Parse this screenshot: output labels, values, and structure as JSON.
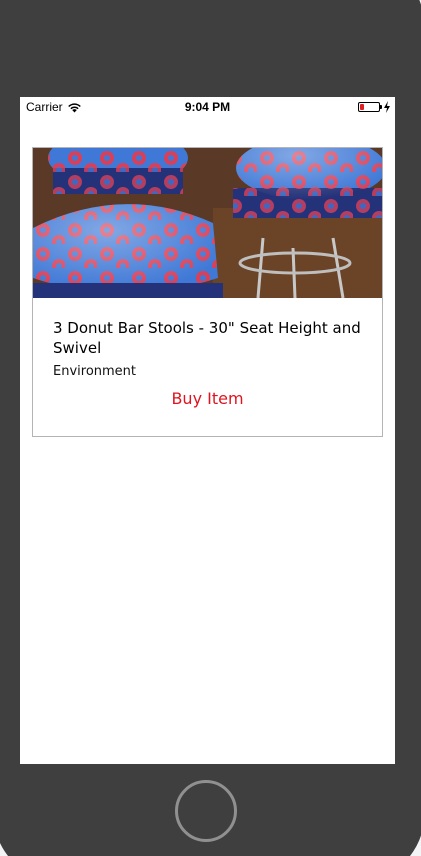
{
  "status_bar": {
    "carrier": "Carrier",
    "time": "9:04 PM",
    "battery_fraction": 0.15,
    "icons": [
      "wifi-icon",
      "battery-icon",
      "charging-bolt-icon"
    ]
  },
  "card": {
    "image": "bar-stools-photo",
    "title": "3 Donut Bar Stools - 30\" Seat Height and Swivel",
    "category": "Environment",
    "buy_label": "Buy Item"
  },
  "colors": {
    "accent": "#e0141e",
    "device_frame": "#3f3f3f",
    "card_border": "#b4b4b4"
  }
}
